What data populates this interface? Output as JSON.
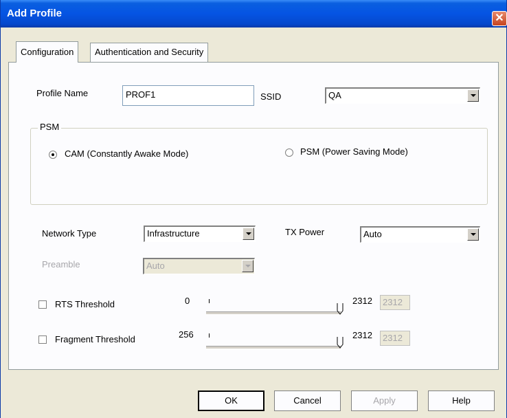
{
  "window": {
    "title": "Add Profile",
    "close_glyph": "✕"
  },
  "tabs": [
    {
      "label": "Configuration",
      "active": true
    },
    {
      "label": "Authentication and Security",
      "active": false
    }
  ],
  "form": {
    "profile_name": {
      "label": "Profile Name",
      "value": "PROF1"
    },
    "ssid": {
      "label": "SSID",
      "value": "QA"
    },
    "psm_group": {
      "title": "PSM",
      "options": [
        {
          "label": "CAM (Constantly Awake Mode)",
          "selected": true
        },
        {
          "label": "PSM (Power Saving Mode)",
          "selected": false
        }
      ]
    },
    "network_type": {
      "label": "Network Type",
      "value": "Infrastructure"
    },
    "tx_power": {
      "label": "TX Power",
      "value": "Auto"
    },
    "preamble": {
      "label": "Preamble",
      "value": "Auto",
      "disabled": true
    },
    "rts_threshold": {
      "label": "RTS Threshold",
      "checked": false,
      "min": "0",
      "max": "2312",
      "value": "2312"
    },
    "fragment_threshold": {
      "label": "Fragment Threshold",
      "checked": false,
      "min": "256",
      "max": "2312",
      "value": "2312"
    }
  },
  "buttons": {
    "ok": "OK",
    "cancel": "Cancel",
    "apply": "Apply",
    "help": "Help"
  },
  "colors": {
    "titlebar": "#0554e3",
    "dialog_bg": "#ece9d8",
    "close": "#c8431f",
    "disabled_text": "#a7a6aa"
  },
  "icons": {
    "close": "close-icon",
    "dropdown": "chevron-down-icon"
  }
}
